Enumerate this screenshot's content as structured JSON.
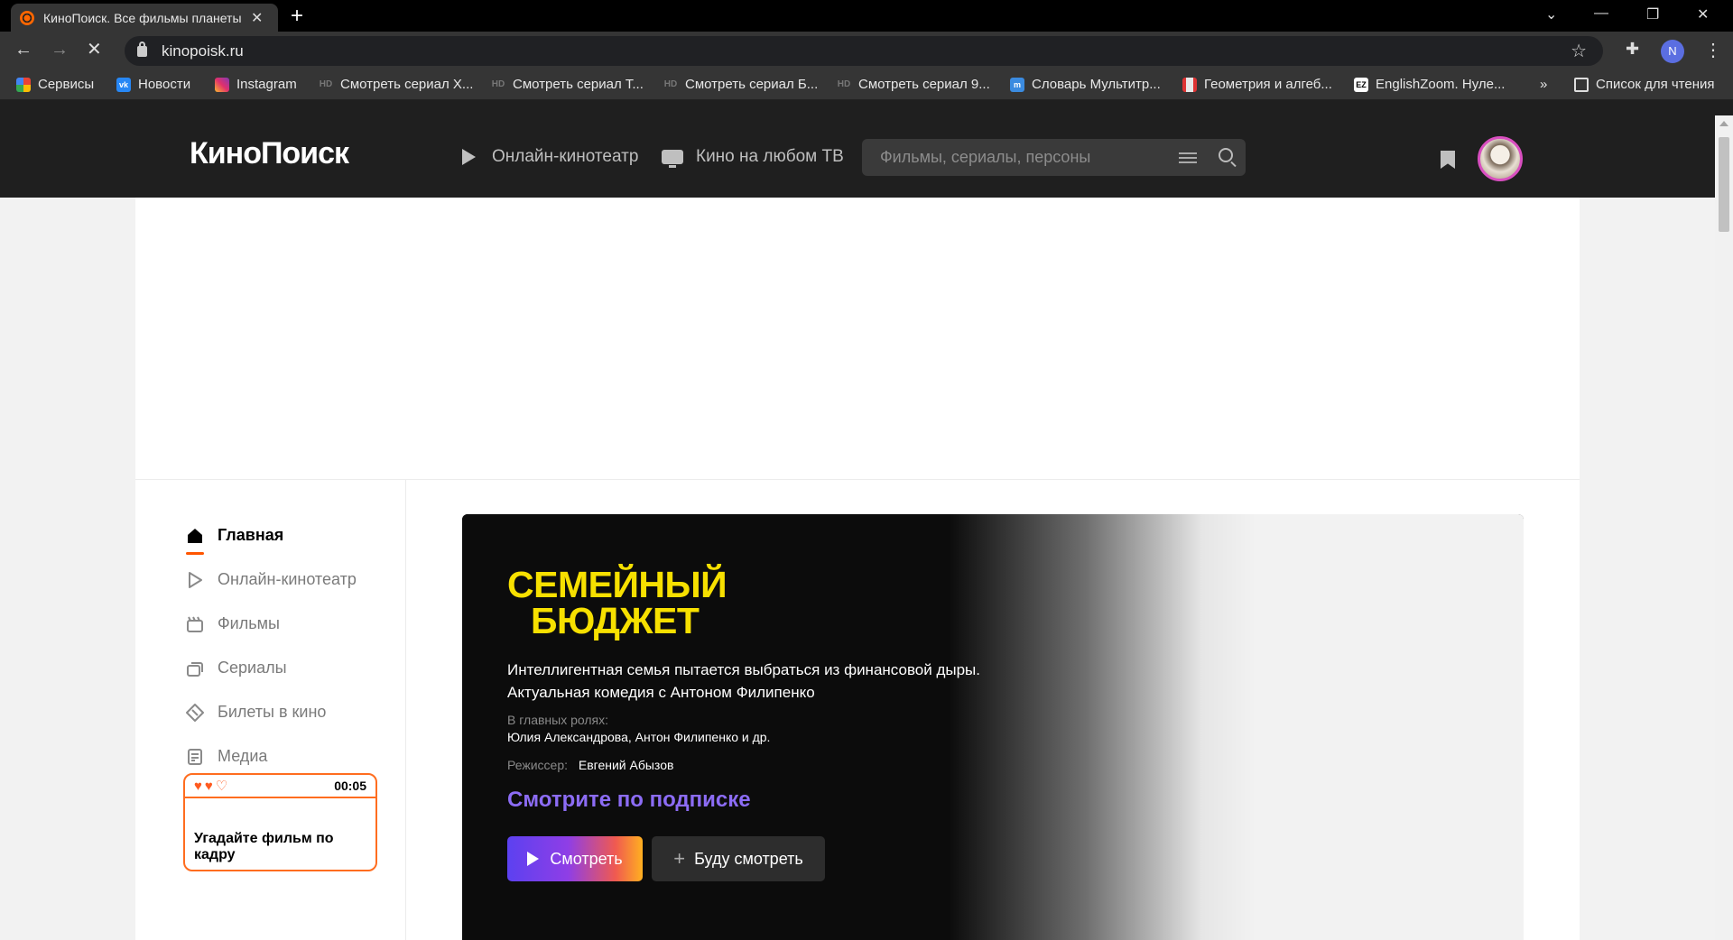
{
  "browser": {
    "tab_title": "КиноПоиск. Все фильмы планеты",
    "url": "kinopoisk.ru",
    "profile_letter": "N",
    "bookmarks": [
      {
        "label": "Сервисы",
        "icon": "apps-grid-icon"
      },
      {
        "label": "Новости",
        "icon": "vk-icon"
      },
      {
        "label": "Instagram",
        "icon": "instagram-icon"
      },
      {
        "label": "Смотреть сериал Х...",
        "icon": "hd-icon"
      },
      {
        "label": "Смотреть сериал Т...",
        "icon": "hd-icon"
      },
      {
        "label": "Смотреть сериал Б...",
        "icon": "hd-icon"
      },
      {
        "label": "Смотреть сериал 9...",
        "icon": "hd-icon"
      },
      {
        "label": "Словарь Мультитр...",
        "icon": "multitran-icon"
      },
      {
        "label": "Геометрия и алгеб...",
        "icon": "geometry-icon"
      },
      {
        "label": "EnglishZoom. Нуле...",
        "icon": "englishzoom-icon"
      }
    ],
    "more_bookmarks": "»",
    "reading_list": "Список для чтения"
  },
  "site_header": {
    "logo": "КиноПоиск",
    "nav": [
      {
        "label": "Онлайн-кинотеатр",
        "icon": "play-icon"
      },
      {
        "label": "Кино на любом ТВ",
        "icon": "tv-icon"
      }
    ],
    "search_placeholder": "Фильмы, сериалы, персоны"
  },
  "sidebar": {
    "items": [
      {
        "label": "Главная",
        "icon": "home-icon",
        "active": true
      },
      {
        "label": "Онлайн-кинотеатр",
        "icon": "play-outline-icon"
      },
      {
        "label": "Фильмы",
        "icon": "clapper-icon"
      },
      {
        "label": "Сериалы",
        "icon": "series-icon"
      },
      {
        "label": "Билеты в кино",
        "icon": "ticket-icon"
      },
      {
        "label": "Медиа",
        "icon": "media-icon"
      }
    ],
    "game": {
      "hearts": "♥♥♡",
      "timer": "00:05",
      "title": "Угадайте фильм по кадру"
    }
  },
  "hero": {
    "logo_line1": "СЕМЕЙНЫЙ",
    "logo_line2": "БЮДЖЕТ",
    "description_line1": "Интеллигентная семья пытается выбраться из финансовой дыры.",
    "description_line2": "Актуальная комедия с Антоном Филипенко",
    "cast_label": "В главных ролях:",
    "cast": "Юлия Александрова, Антон Филипенко и др.",
    "director_label": "Режиссер:",
    "director": "Евгений Абызов",
    "subscription_text": "Смотрите по подписке",
    "watch_button": "Смотреть",
    "later_button": "Буду смотреть"
  },
  "colors": {
    "accent_orange": "#ff5500",
    "subscription_purple": "#8c6cf5",
    "hero_logo_yellow": "#f7e000"
  }
}
